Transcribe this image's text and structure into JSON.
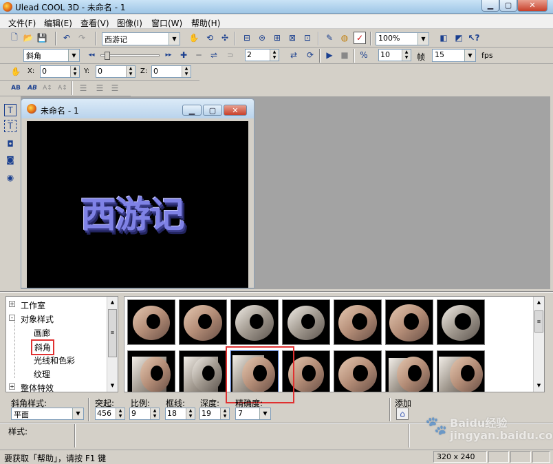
{
  "window": {
    "title": "Ulead COOL 3D - 未命名 - 1"
  },
  "menu": [
    "文件(F)",
    "编辑(E)",
    "查看(V)",
    "图像(I)",
    "窗口(W)",
    "帮助(H)"
  ],
  "toolbar": {
    "text_combo": "西游记",
    "zoom_combo": "100%",
    "object_combo": "斜角",
    "frame_value": "2",
    "frames_total": "10",
    "frame_label": "帧",
    "fps_value": "15",
    "fps_label": "fps"
  },
  "position": {
    "x_label": "X:",
    "x_value": "0",
    "y_label": "Y:",
    "y_value": "0",
    "z_label": "Z:",
    "z_value": "0"
  },
  "document": {
    "title": "未命名 - 1",
    "text": "西游记"
  },
  "tree": {
    "items": [
      {
        "label": "工作室",
        "toggle": "+"
      },
      {
        "label": "对象样式",
        "toggle": "-"
      },
      {
        "label": "画廊"
      },
      {
        "label": "斜角"
      },
      {
        "label": "光线和色彩"
      },
      {
        "label": "纹理"
      },
      {
        "label": "整体特效",
        "toggle": "+"
      }
    ]
  },
  "props": {
    "style_label": "斜角样式:",
    "style_value": "平面",
    "protrude_label": "突起:",
    "protrude_value": "456",
    "ratio_label": "比例:",
    "ratio_value": "9",
    "border_label": "框线:",
    "border_value": "18",
    "depth_label": "深度:",
    "depth_value": "19",
    "precision_label": "精确度:",
    "precision_value": "7",
    "add_label": "添加",
    "styles_label": "样式:"
  },
  "status": {
    "help": "要获取「帮助」，请按 F1 键",
    "size": "320 x 240"
  },
  "colors": {
    "accent_highlight": "#e03030",
    "text_3d": "#6d6fd8",
    "canvas_bg": "#000000"
  },
  "watermark": "Baidu经验 jingyan.baidu.com"
}
